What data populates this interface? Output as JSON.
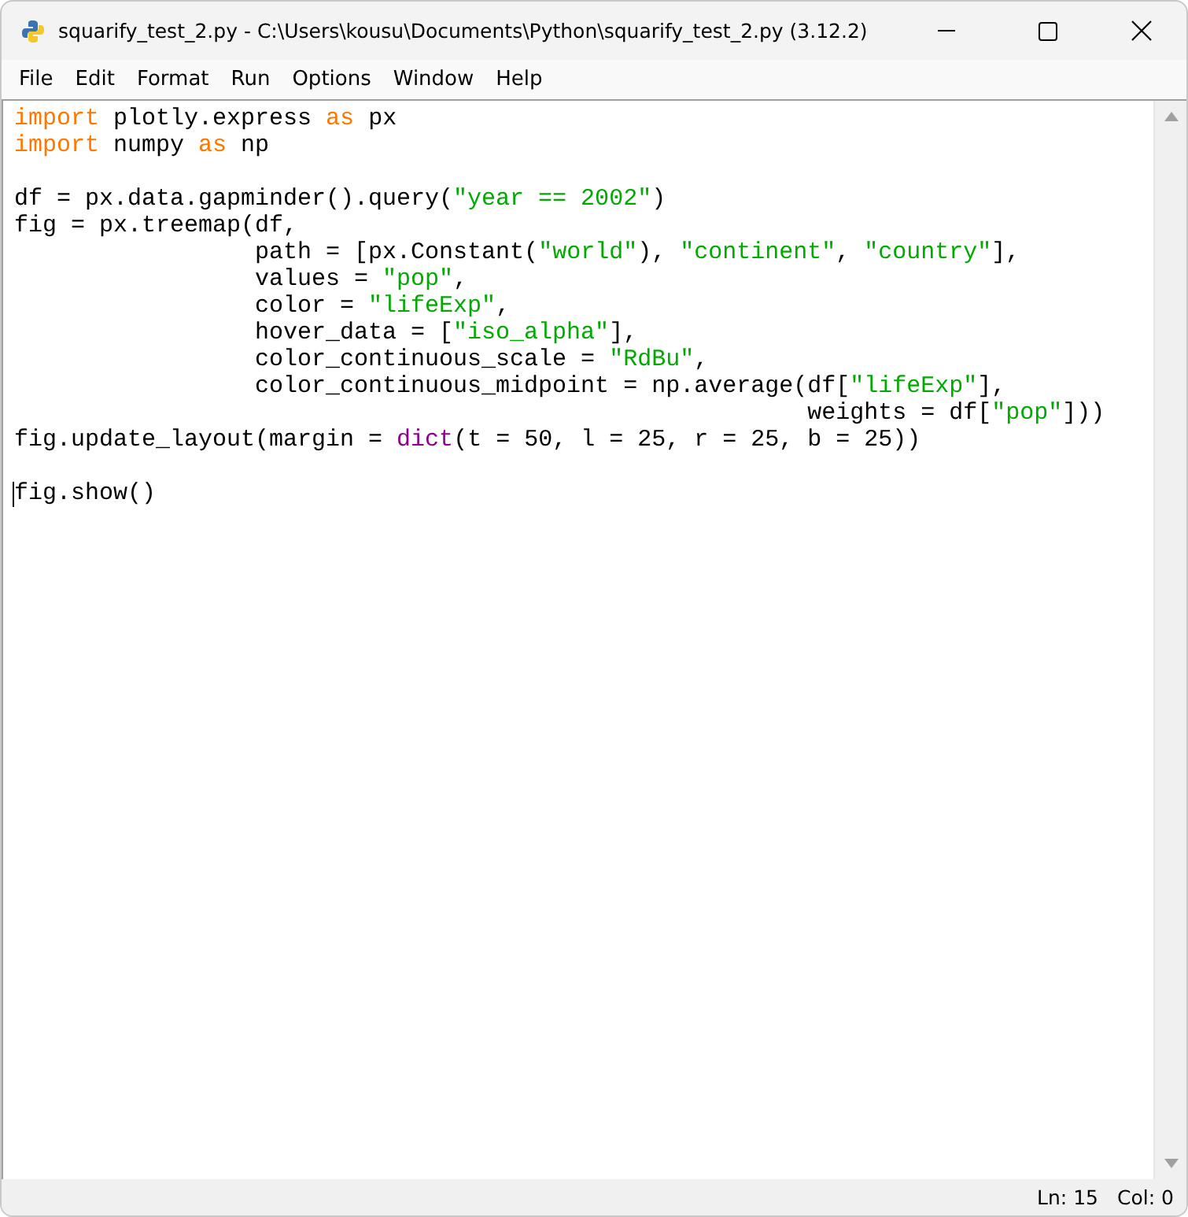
{
  "window": {
    "title": "squarify_test_2.py - C:\\Users\\kousu\\Documents\\Python\\squarify_test_2.py (3.12.2)"
  },
  "menu": [
    "File",
    "Edit",
    "Format",
    "Run",
    "Options",
    "Window",
    "Help"
  ],
  "editor": {
    "lines": [
      {
        "cursor": false,
        "tokens": [
          {
            "kind": "keyword",
            "text": "import"
          },
          {
            "kind": "plain",
            "text": " plotly.express "
          },
          {
            "kind": "keyword",
            "text": "as"
          },
          {
            "kind": "plain",
            "text": " px"
          }
        ]
      },
      {
        "cursor": false,
        "tokens": [
          {
            "kind": "keyword",
            "text": "import"
          },
          {
            "kind": "plain",
            "text": " numpy "
          },
          {
            "kind": "keyword",
            "text": "as"
          },
          {
            "kind": "plain",
            "text": " np"
          }
        ]
      },
      {
        "cursor": false
      },
      {
        "cursor": false,
        "tokens": [
          {
            "kind": "plain",
            "text": "df = px.data.gapminder().query("
          },
          {
            "kind": "string",
            "text": "\"year == 2002\""
          },
          {
            "kind": "plain",
            "text": ")"
          }
        ]
      },
      {
        "cursor": false,
        "tokens": [
          {
            "kind": "plain",
            "text": "fig = px.treemap(df,"
          }
        ]
      },
      {
        "cursor": false,
        "tokens": [
          {
            "kind": "plain",
            "text": "                 path = [px.Constant("
          },
          {
            "kind": "string",
            "text": "\"world\""
          },
          {
            "kind": "plain",
            "text": "), "
          },
          {
            "kind": "string",
            "text": "\"continent\""
          },
          {
            "kind": "plain",
            "text": ", "
          },
          {
            "kind": "string",
            "text": "\"country\""
          },
          {
            "kind": "plain",
            "text": "],"
          }
        ]
      },
      {
        "cursor": false,
        "tokens": [
          {
            "kind": "plain",
            "text": "                 values = "
          },
          {
            "kind": "string",
            "text": "\"pop\""
          },
          {
            "kind": "plain",
            "text": ","
          }
        ]
      },
      {
        "cursor": false,
        "tokens": [
          {
            "kind": "plain",
            "text": "                 color = "
          },
          {
            "kind": "string",
            "text": "\"lifeExp\""
          },
          {
            "kind": "plain",
            "text": ","
          }
        ]
      },
      {
        "cursor": false,
        "tokens": [
          {
            "kind": "plain",
            "text": "                 hover_data = ["
          },
          {
            "kind": "string",
            "text": "\"iso_alpha\""
          },
          {
            "kind": "plain",
            "text": "],"
          }
        ]
      },
      {
        "cursor": false,
        "tokens": [
          {
            "kind": "plain",
            "text": "                 color_continuous_scale = "
          },
          {
            "kind": "string",
            "text": "\"RdBu\""
          },
          {
            "kind": "plain",
            "text": ","
          }
        ]
      },
      {
        "cursor": false,
        "tokens": [
          {
            "kind": "plain",
            "text": "                 color_continuous_midpoint = np.average(df["
          },
          {
            "kind": "string",
            "text": "\"lifeExp\""
          },
          {
            "kind": "plain",
            "text": "],"
          }
        ]
      },
      {
        "cursor": false,
        "tokens": [
          {
            "kind": "plain",
            "text": "                                                        weights = df["
          },
          {
            "kind": "string",
            "text": "\"pop\""
          },
          {
            "kind": "plain",
            "text": "]))"
          }
        ]
      },
      {
        "cursor": false,
        "tokens": [
          {
            "kind": "plain",
            "text": "fig.update_layout(margin = "
          },
          {
            "kind": "builtin",
            "text": "dict"
          },
          {
            "kind": "plain",
            "text": "(t = 50, l = 25, r = 25, b = 25))"
          }
        ]
      },
      {
        "cursor": false
      },
      {
        "cursor": true,
        "tokens": [
          {
            "kind": "plain",
            "text": "fig.show()"
          }
        ]
      }
    ]
  },
  "status_bar": {
    "line": "Ln: 15",
    "column": "Col: 0"
  }
}
